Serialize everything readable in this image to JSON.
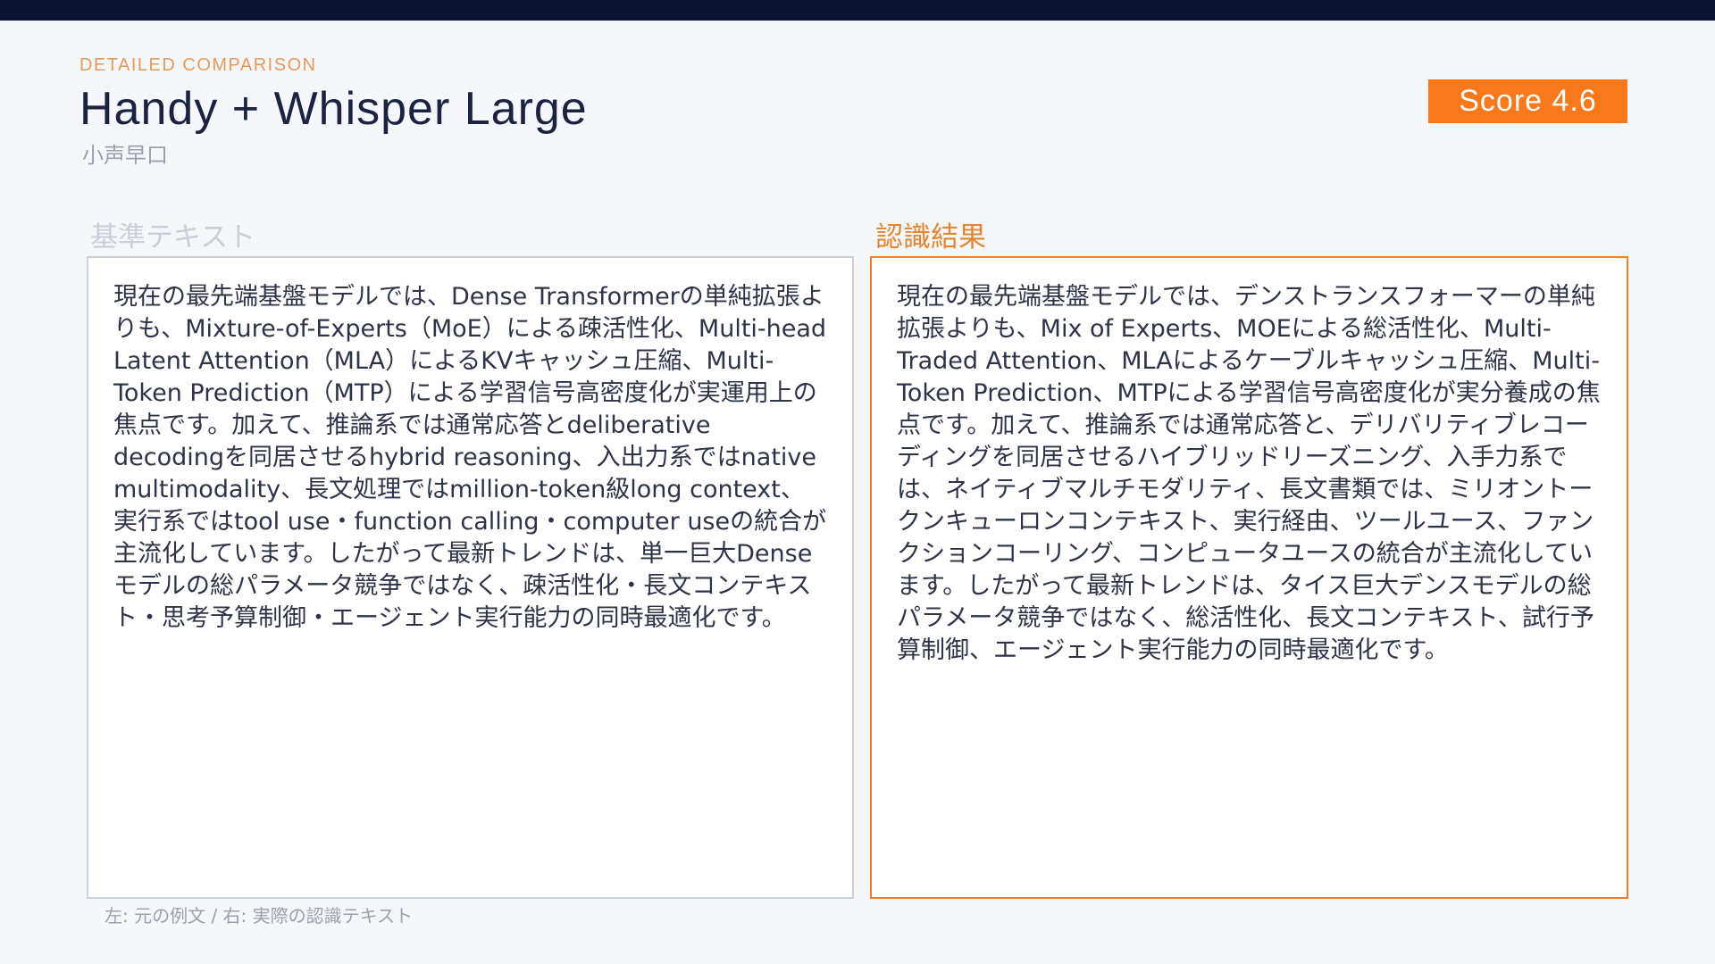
{
  "header": {
    "eyebrow": "DETAILED COMPARISON",
    "title": "Handy + Whisper Large",
    "subtitle": "小声早口",
    "score": "Score 4.6"
  },
  "reference": {
    "label": "基準テキスト",
    "text": "現在の最先端基盤モデルでは、Dense Transformerの単純拡張よりも、Mixture-of-Experts（MoE）による疎活性化、Multi-head Latent Attention（MLA）によるKVキャッシュ圧縮、Multi-Token Prediction（MTP）による学習信号高密度化が実運用上の焦点です。加えて、推論系では通常応答とdeliberative decodingを同居させるhybrid reasoning、入出力系ではnative multimodality、長文処理ではmillion-token級long context、実行系ではtool use・function calling・computer useの統合が主流化しています。したがって最新トレンドは、単一巨大Denseモデルの総パラメータ競争ではなく、疎活性化・長文コンテキスト・思考予算制御・エージェント実行能力の同時最適化です。"
  },
  "result": {
    "label": "認識結果",
    "text": "現在の最先端基盤モデルでは、デンストランスフォーマーの単純拡張よりも、Mix of Experts、MOEによる総活性化、Multi-Traded Attention、MLAによるケーブルキャッシュ圧縮、Multi-Token Prediction、MTPによる学習信号高密度化が実分養成の焦点です。加えて、推論系では通常応答と、デリバリティブレコーディングを同居させるハイブリッドリーズニング、入手力系では、ネイティブマルチモダリティ、長文書類では、ミリオントークンキューロンコンテキスト、実行経由、ツールユース、ファンクションコーリング、コンピュータユースの統合が主流化しています。したがって最新トレンドは、タイス巨大デンスモデルの総パラメータ競争ではなく、総活性化、長文コンテキスト、試行予算制御、エージェント実行能力の同時最適化です。"
  },
  "footnote": "左: 元の例文 / 右: 実際の認識テキスト",
  "colors": {
    "accent": "#f7791b",
    "top_bar": "#0c1634"
  }
}
